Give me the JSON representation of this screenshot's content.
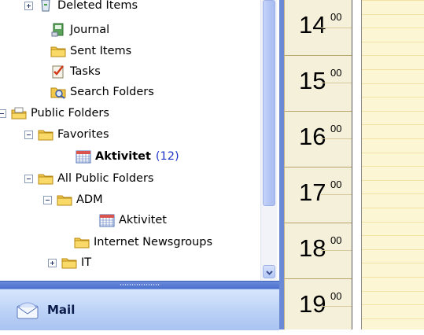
{
  "folder_tree": [
    {
      "id": "deleted-items",
      "label": "Deleted Items",
      "icon": "deleted-items-icon",
      "toggle": "plus"
    },
    {
      "id": "journal",
      "label": "Journal",
      "icon": "journal-icon"
    },
    {
      "id": "sent-items",
      "label": "Sent Items",
      "icon": "folder-icon"
    },
    {
      "id": "tasks",
      "label": "Tasks",
      "icon": "tasks-icon"
    },
    {
      "id": "search-folders",
      "label": "Search Folders",
      "icon": "search-folder-icon"
    },
    {
      "id": "public-folders",
      "label": "Public Folders",
      "icon": "public-folders-icon",
      "toggle": "minus"
    },
    {
      "id": "favorites",
      "label": "Favorites",
      "icon": "folder-icon",
      "toggle": "minus"
    },
    {
      "id": "aktivitet-favorite",
      "label": "Aktivitet",
      "count": "(12)",
      "icon": "calendar-icon",
      "bold": true
    },
    {
      "id": "all-public-folders",
      "label": "All Public Folders",
      "icon": "folder-icon",
      "toggle": "minus"
    },
    {
      "id": "adm",
      "label": "ADM",
      "icon": "folder-icon",
      "toggle": "minus"
    },
    {
      "id": "aktivitet",
      "label": "Aktivitet",
      "icon": "calendar-icon"
    },
    {
      "id": "internet-newsgroups",
      "label": "Internet Newsgroups",
      "icon": "folder-icon"
    },
    {
      "id": "it",
      "label": "IT",
      "icon": "folder-icon",
      "toggle": "plus"
    }
  ],
  "navigation": {
    "mail_label": "Mail",
    "mail_icon": "mail-envelope-icon"
  },
  "calendar": {
    "hours": [
      {
        "hour": "14",
        "minutes": "00"
      },
      {
        "hour": "15",
        "minutes": "00"
      },
      {
        "hour": "16",
        "minutes": "00"
      },
      {
        "hour": "17",
        "minutes": "00"
      },
      {
        "hour": "18",
        "minutes": "00"
      },
      {
        "hour": "19",
        "minutes": "00"
      }
    ]
  },
  "colors": {
    "accent_blue": "#6b8ad6",
    "unread_count": "#1f35c9",
    "time_column_bg": "#f5f0da",
    "day_area_bg": "#fdf6d4"
  }
}
